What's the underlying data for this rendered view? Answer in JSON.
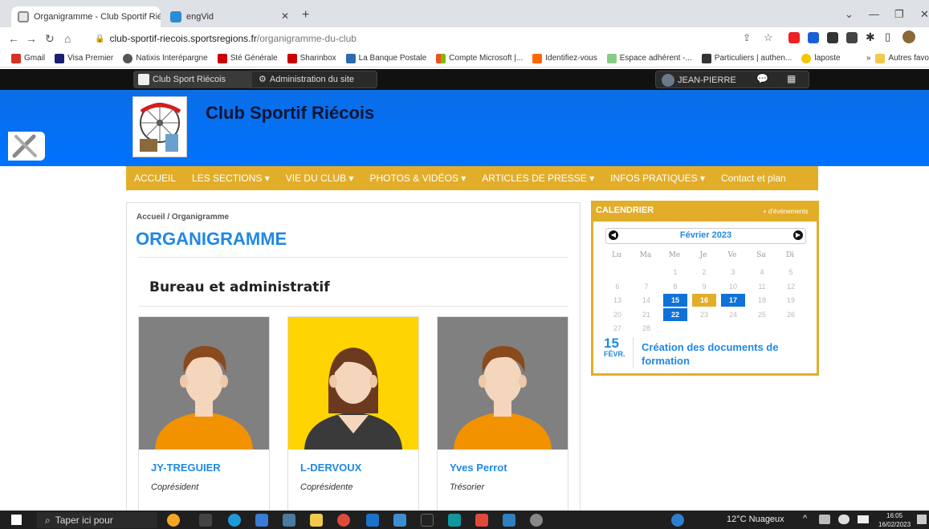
{
  "browser": {
    "tabs": [
      {
        "title": "Organigramme - Club Sportif Rié",
        "active": true
      },
      {
        "title": "engVid",
        "active": false
      }
    ],
    "new_tab_label": "+",
    "address": {
      "host": "club-sportif-riecois.sportsregions.fr",
      "path": "/organigramme-du-club"
    },
    "bookmarks": [
      "Gmail",
      "Visa Premier",
      "Natixis Interépargne",
      "Sté Générale",
      "Sharinbox",
      "La Banque Postale",
      "Compte Microsoft |...",
      "Identifiez-vous",
      "Espace adhérent -...",
      "Particuliers | authen...",
      "laposte"
    ],
    "bookmarks_more": "»",
    "other_bookmarks": "Autres favo"
  },
  "adminbar": {
    "site_link": "Club Sport Riécois",
    "admin_link": "Administration du site",
    "user": "JEAN-PIERRE"
  },
  "header": {
    "title": "Club Sportif Riécois",
    "logo_text": "Club Sportif Riécois"
  },
  "nav": {
    "items": [
      "ACCUEIL",
      "LES SECTIONS ▾",
      "VIE DU CLUB ▾",
      "PHOTOS & VIDÉOS ▾",
      "ARTICLES DE PRESSE ▾",
      "INFOS PRATIQUES ▾",
      "Contact et plan"
    ]
  },
  "main": {
    "breadcrumb": "Accueil  /  Organigramme",
    "title": "ORGANIGRAMME",
    "section": "Bureau et administratif",
    "members": [
      {
        "name": "JY-TREGUIER",
        "role": "Coprésident",
        "bg": "#808080",
        "gender": "m"
      },
      {
        "name": "L-DERVOUX",
        "role": "Coprésidente",
        "bg": "#ffd400",
        "gender": "f"
      },
      {
        "name": "Yves Perrot",
        "role": "Trésorier",
        "bg": "#808080",
        "gender": "m"
      }
    ]
  },
  "calendar": {
    "title": "CALENDRIER",
    "more": "+ d'événements",
    "month": "Février 2023",
    "weekdays": [
      "Lu",
      "Ma",
      "Me",
      "Je",
      "Ve",
      "Sa",
      "Di"
    ],
    "weeks": [
      [
        "",
        "",
        "1",
        "2",
        "3",
        "4",
        "5"
      ],
      [
        "6",
        "7",
        "8",
        "9",
        "10",
        "11",
        "12"
      ],
      [
        "13",
        "14",
        "15",
        "16",
        "17",
        "18",
        "19"
      ],
      [
        "20",
        "21",
        "22",
        "23",
        "24",
        "25",
        "26"
      ],
      [
        "27",
        "28",
        "",
        "",
        "",
        "",
        ""
      ]
    ],
    "highlight_blue": [
      "15",
      "17",
      "22"
    ],
    "highlight_gold": [
      "16"
    ],
    "event": {
      "day": "15",
      "month": "FÉVR.",
      "title": "Création des documents de formation"
    }
  },
  "taskbar": {
    "search_placeholder": "Taper ici pour",
    "weather": "12°C Nuageux",
    "time": "16:05",
    "date": "16/02/2023"
  },
  "colors": {
    "accent_blue": "#1f88e5",
    "gold": "#e2ae2a",
    "header_blue": "#0072ff"
  }
}
